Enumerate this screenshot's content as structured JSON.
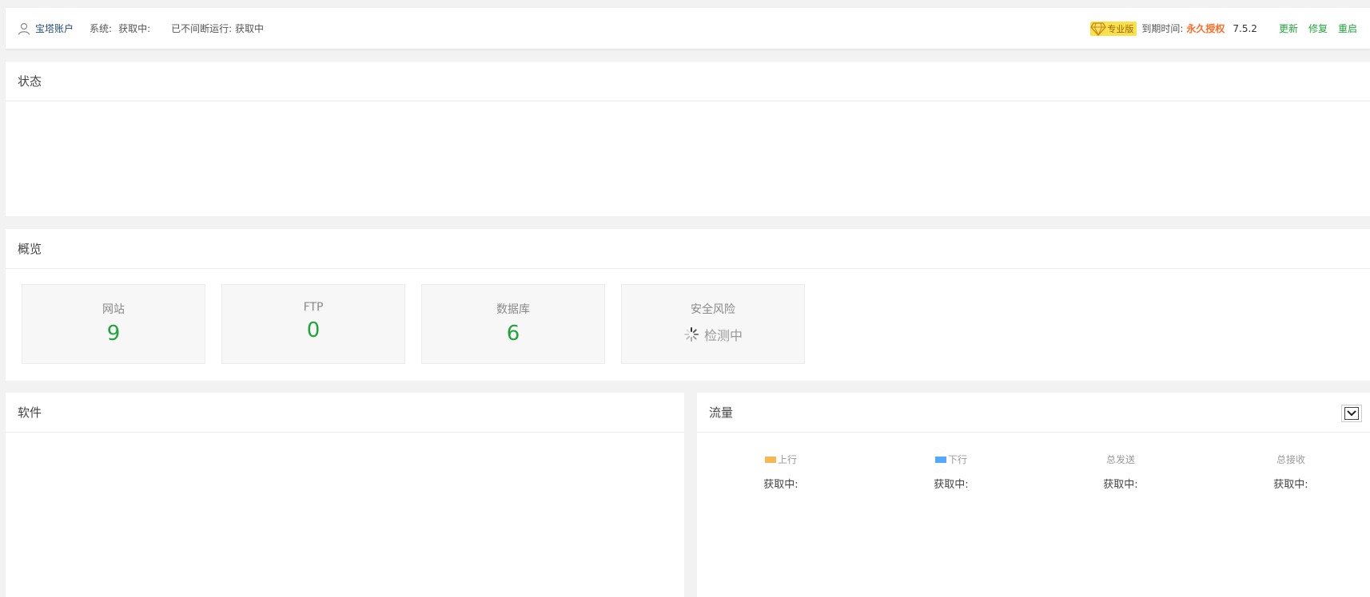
{
  "topbar": {
    "account": "宝塔账户",
    "system_label": "系统:",
    "system_value": "获取中:",
    "uptime": "已不间断运行: 获取中",
    "pro_badge": "专业版",
    "expire_label": "到期时间:",
    "expire_value": "永久授权",
    "version": "7.5.2",
    "actions": [
      "更新",
      "修复",
      "重启"
    ]
  },
  "status": {
    "title": "状态"
  },
  "overview": {
    "title": "概览",
    "cards": [
      {
        "label": "网站",
        "value": "9"
      },
      {
        "label": "FTP",
        "value": "0"
      },
      {
        "label": "数据库",
        "value": "6"
      },
      {
        "label": "安全风险",
        "value": "检测中"
      }
    ]
  },
  "software": {
    "title": "软件"
  },
  "traffic": {
    "title": "流量",
    "columns": [
      {
        "label": "上行",
        "value": "获取中:",
        "color": "#f7b851"
      },
      {
        "label": "下行",
        "value": "获取中:",
        "color": "#52a9ff"
      },
      {
        "label": "总发送",
        "value": "获取中:"
      },
      {
        "label": "总接收",
        "value": "获取中:"
      }
    ]
  },
  "colors": {
    "accent": "#20a53a",
    "expire": "#fc6d26",
    "badge": "#f7e24d"
  }
}
